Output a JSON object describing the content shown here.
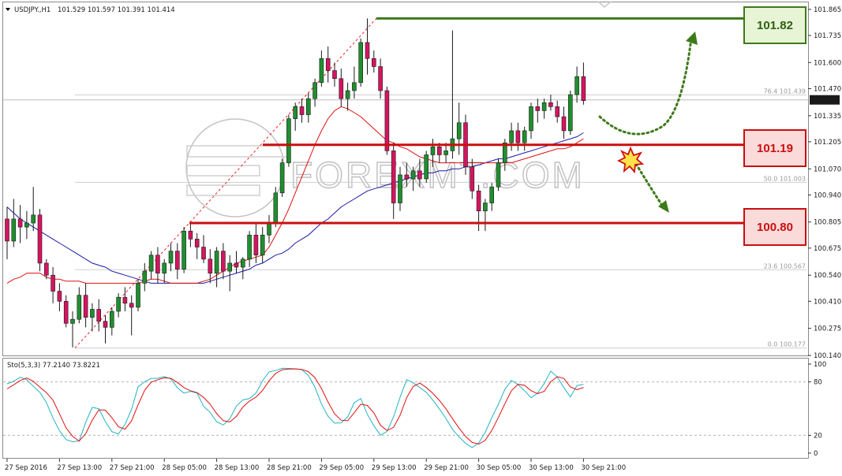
{
  "header": {
    "symbol": "USDJPY.,H1",
    "ohlc": "101.529 101.597 101.391 101.414"
  },
  "price_axis": {
    "ticks": [
      "101.865",
      "101.735",
      "101.600",
      "101.470",
      "101.335",
      "101.205",
      "101.070",
      "100.940",
      "100.805",
      "100.675",
      "100.540",
      "100.410",
      "100.275",
      "100.140"
    ],
    "current_price": "101.414"
  },
  "time_axis": {
    "ticks": [
      "27 Sep 2016",
      "27 Sep 13:00",
      "27 Sep 21:00",
      "28 Sep 05:00",
      "28 Sep 13:00",
      "28 Sep 21:00",
      "29 Sep 05:00",
      "29 Sep 13:00",
      "29 Sep 21:00",
      "30 Sep 05:00",
      "30 Sep 13:00",
      "30 Sep 21:00"
    ]
  },
  "fib_levels": [
    {
      "label": "76.4  101.439"
    },
    {
      "label": "50.0  101.003"
    },
    {
      "label": "23.6  100.567"
    },
    {
      "label": "0.0  100.177"
    }
  ],
  "levels": {
    "resistance": "101.82",
    "pivot": "101.19",
    "support": "100.80"
  },
  "indicator": {
    "label": "Sto(5,3,3) 77.2140 73.8221",
    "ticks": [
      "100",
      "80",
      "20",
      "0"
    ]
  },
  "watermark": "FOREXMT.COM",
  "colors": {
    "bull": "#1f8f2e",
    "bear": "#d6145f",
    "ma_fast": "#e01010",
    "ma_slow": "#1a1aa8",
    "stoch_main": "#24b4c4",
    "stoch_signal": "#e01010",
    "resistance_box": "#e7f5d6",
    "support_box": "#fbdada"
  },
  "chart_data": {
    "type": "candlestick",
    "timeframe": "H1",
    "xlabel": "",
    "ylabel": "",
    "ylim": [
      100.14,
      101.9
    ],
    "start": "27 Sep 2016 00:00",
    "candles": [
      [
        100.82,
        100.88,
        100.62,
        100.71
      ],
      [
        100.71,
        100.92,
        100.68,
        100.82
      ],
      [
        100.82,
        100.89,
        100.7,
        100.78
      ],
      [
        100.78,
        100.86,
        100.72,
        100.8
      ],
      [
        100.8,
        100.98,
        100.76,
        100.84
      ],
      [
        100.84,
        100.87,
        100.56,
        100.6
      ],
      [
        100.6,
        100.62,
        100.52,
        100.54
      ],
      [
        100.54,
        100.58,
        100.4,
        100.46
      ],
      [
        100.46,
        100.5,
        100.36,
        100.41
      ],
      [
        100.41,
        100.44,
        100.28,
        100.3
      ],
      [
        100.3,
        100.36,
        100.18,
        100.32
      ],
      [
        100.32,
        100.48,
        100.3,
        100.44
      ],
      [
        100.44,
        100.5,
        100.28,
        100.33
      ],
      [
        100.33,
        100.4,
        100.26,
        100.37
      ],
      [
        100.37,
        100.42,
        100.26,
        100.31
      ],
      [
        100.31,
        100.34,
        100.2,
        100.28
      ],
      [
        100.28,
        100.38,
        100.24,
        100.36
      ],
      [
        100.36,
        100.45,
        100.33,
        100.43
      ],
      [
        100.43,
        100.48,
        100.36,
        100.4
      ],
      [
        100.4,
        100.44,
        100.24,
        100.38
      ],
      [
        100.38,
        100.52,
        100.36,
        100.5
      ],
      [
        100.5,
        100.6,
        100.46,
        100.56
      ],
      [
        100.56,
        100.66,
        100.52,
        100.64
      ],
      [
        100.64,
        100.68,
        100.5,
        100.55
      ],
      [
        100.55,
        100.62,
        100.5,
        100.6
      ],
      [
        100.6,
        100.7,
        100.56,
        100.66
      ],
      [
        100.66,
        100.7,
        100.52,
        100.57
      ],
      [
        100.57,
        100.78,
        100.55,
        100.76
      ],
      [
        100.76,
        100.8,
        100.68,
        100.72
      ],
      [
        100.72,
        100.75,
        100.62,
        100.68
      ],
      [
        100.68,
        100.74,
        100.6,
        100.62
      ],
      [
        100.62,
        100.67,
        100.5,
        100.55
      ],
      [
        100.55,
        100.68,
        100.48,
        100.66
      ],
      [
        100.66,
        100.7,
        100.52,
        100.56
      ],
      [
        100.56,
        100.64,
        100.46,
        100.6
      ],
      [
        100.6,
        100.66,
        100.55,
        100.58
      ],
      [
        100.58,
        100.63,
        100.52,
        100.62
      ],
      [
        100.62,
        100.76,
        100.58,
        100.74
      ],
      [
        100.74,
        100.8,
        100.6,
        100.64
      ],
      [
        100.64,
        100.78,
        100.6,
        100.74
      ],
      [
        100.74,
        100.84,
        100.7,
        100.8
      ],
      [
        100.8,
        100.98,
        100.78,
        100.95
      ],
      [
        100.95,
        101.12,
        100.93,
        101.1
      ],
      [
        101.1,
        101.34,
        101.08,
        101.32
      ],
      [
        101.32,
        101.4,
        101.26,
        101.38
      ],
      [
        101.38,
        101.42,
        101.3,
        101.34
      ],
      [
        101.34,
        101.45,
        101.3,
        101.42
      ],
      [
        101.42,
        101.52,
        101.38,
        101.5
      ],
      [
        101.5,
        101.66,
        101.48,
        101.62
      ],
      [
        101.62,
        101.68,
        101.5,
        101.56
      ],
      [
        101.56,
        101.6,
        101.48,
        101.52
      ],
      [
        101.52,
        101.57,
        101.38,
        101.42
      ],
      [
        101.42,
        101.5,
        101.36,
        101.46
      ],
      [
        101.46,
        101.58,
        101.42,
        101.5
      ],
      [
        101.5,
        101.72,
        101.48,
        101.7
      ],
      [
        101.7,
        101.82,
        101.54,
        101.62
      ],
      [
        101.62,
        101.66,
        101.55,
        101.58
      ],
      [
        101.58,
        101.62,
        101.42,
        101.46
      ],
      [
        101.46,
        101.48,
        101.14,
        101.16
      ],
      [
        101.16,
        101.2,
        100.82,
        100.9
      ],
      [
        100.9,
        101.08,
        100.86,
        101.04
      ],
      [
        101.04,
        101.1,
        100.98,
        101.02
      ],
      [
        101.02,
        101.08,
        100.96,
        101.06
      ],
      [
        101.06,
        101.12,
        100.98,
        101.02
      ],
      [
        101.02,
        101.16,
        101.0,
        101.14
      ],
      [
        101.14,
        101.22,
        101.08,
        101.18
      ],
      [
        101.18,
        101.2,
        101.1,
        101.14
      ],
      [
        101.14,
        101.2,
        101.1,
        101.16
      ],
      [
        101.16,
        101.76,
        101.12,
        101.22
      ],
      [
        101.22,
        101.4,
        101.14,
        101.3
      ],
      [
        101.3,
        101.34,
        101.04,
        101.08
      ],
      [
        101.08,
        101.12,
        100.92,
        100.96
      ],
      [
        100.96,
        100.99,
        100.76,
        100.86
      ],
      [
        100.86,
        100.92,
        100.76,
        100.9
      ],
      [
        100.9,
        101.0,
        100.86,
        100.98
      ],
      [
        100.98,
        101.12,
        100.96,
        101.1
      ],
      [
        101.1,
        101.22,
        101.06,
        101.2
      ],
      [
        101.2,
        101.3,
        101.16,
        101.26
      ],
      [
        101.26,
        101.3,
        101.16,
        101.2
      ],
      [
        101.2,
        101.28,
        101.16,
        101.26
      ],
      [
        101.26,
        101.4,
        101.22,
        101.38
      ],
      [
        101.38,
        101.42,
        101.3,
        101.36
      ],
      [
        101.36,
        101.42,
        101.32,
        101.4
      ],
      [
        101.4,
        101.44,
        101.36,
        101.38
      ],
      [
        101.38,
        101.41,
        101.3,
        101.33
      ],
      [
        101.33,
        101.38,
        101.22,
        101.26
      ],
      [
        101.26,
        101.46,
        101.24,
        101.44
      ],
      [
        101.44,
        101.58,
        101.4,
        101.53
      ],
      [
        101.53,
        101.6,
        101.39,
        101.41
      ]
    ],
    "ma_fast": [
      100.5,
      100.52,
      100.53,
      100.55,
      100.55,
      100.55,
      100.53,
      100.52,
      100.52,
      100.51,
      100.51,
      100.51,
      100.5,
      100.5,
      100.5,
      100.5,
      100.5,
      100.5,
      100.5,
      100.5,
      100.5,
      100.51,
      100.52,
      100.52,
      100.51,
      100.5,
      100.5,
      100.5,
      100.5,
      100.5,
      100.51,
      100.52,
      100.54,
      100.56,
      100.58,
      100.6,
      100.61,
      100.62,
      100.63,
      100.64,
      100.68,
      100.74,
      100.8,
      100.87,
      100.95,
      101.03,
      101.11,
      101.19,
      101.26,
      101.32,
      101.36,
      101.38,
      101.37,
      101.35,
      101.33,
      101.3,
      101.27,
      101.24,
      101.21,
      101.2,
      101.18,
      101.17,
      101.15,
      101.13,
      101.12,
      101.11,
      101.1,
      101.1,
      101.1,
      101.1,
      101.1,
      101.1,
      101.1,
      101.1,
      101.1,
      101.1,
      101.1,
      101.1,
      101.11,
      101.12,
      101.13,
      101.14,
      101.15,
      101.16,
      101.17,
      101.17,
      101.18,
      101.2,
      101.22
    ],
    "ma_slow": [
      100.88,
      100.85,
      100.82,
      100.8,
      100.78,
      100.76,
      100.74,
      100.72,
      100.7,
      100.68,
      100.66,
      100.64,
      100.62,
      100.6,
      100.59,
      100.58,
      100.56,
      100.55,
      100.54,
      100.53,
      100.52,
      100.51,
      100.5,
      100.5,
      100.5,
      100.5,
      100.5,
      100.5,
      100.5,
      100.5,
      100.5,
      100.51,
      100.52,
      100.53,
      100.54,
      100.55,
      100.56,
      100.57,
      100.59,
      100.6,
      100.62,
      100.64,
      100.65,
      100.67,
      100.7,
      100.72,
      100.74,
      100.77,
      100.8,
      100.82,
      100.85,
      100.88,
      100.9,
      100.92,
      100.94,
      100.96,
      100.97,
      100.98,
      100.99,
      101.0,
      101.01,
      101.02,
      101.03,
      101.04,
      101.05,
      101.05,
      101.06,
      101.06,
      101.07,
      101.07,
      101.08,
      101.08,
      101.09,
      101.1,
      101.11,
      101.12,
      101.12,
      101.13,
      101.14,
      101.15,
      101.16,
      101.17,
      101.18,
      101.19,
      101.2,
      101.21,
      101.22,
      101.23,
      101.25
    ],
    "stochastic": {
      "ylim": [
        0,
        100
      ],
      "levels": [
        20,
        80
      ],
      "main": [
        77.9,
        80.6,
        85.2,
        82.5,
        75.1,
        68.3,
        56.8,
        39.6,
        25.1,
        15.2,
        12.8,
        13.7,
        34.6,
        51.3,
        49.9,
        35.5,
        24.2,
        21.6,
        32.3,
        49.1,
        74.5,
        80.2,
        83.8,
        84.1,
        86.0,
        83.4,
        73.4,
        67.4,
        69.3,
        67.4,
        52.6,
        45.7,
        35.2,
        31.6,
        38.7,
        52.8,
        59.8,
        61.2,
        67.4,
        81.3,
        91.2,
        92.7,
        95.3,
        95.1,
        94.7,
        93.6,
        87.2,
        74.0,
        55.1,
        41.4,
        33.7,
        34.0,
        40.8,
        56.6,
        61.3,
        43.6,
        30.7,
        20.2,
        24.3,
        40.7,
        62.7,
        82.5,
        79.0,
        73.7,
        68.3,
        59.6,
        49.7,
        38.9,
        26.6,
        18.2,
        11.0,
        6.3,
        11.4,
        23.4,
        39.8,
        54.9,
        71.8,
        81.7,
        77.0,
        70.2,
        62.2,
        67.4,
        78.1,
        92.1,
        85.5,
        73.7,
        63.1,
        75.9,
        77.2
      ],
      "signal": [
        72.1,
        76.7,
        81.6,
        84.5,
        80.6,
        74.1,
        68.0,
        59.6,
        44.1,
        28.4,
        18.9,
        13.6,
        21.8,
        37.1,
        48.6,
        48.3,
        39.8,
        29.6,
        26.9,
        36.2,
        54.3,
        70.5,
        79.7,
        82.5,
        84.6,
        84.1,
        79.4,
        73.6,
        70.1,
        68.0,
        62.6,
        55.0,
        44.3,
        36.5,
        35.0,
        41.2,
        51.8,
        58.5,
        62.9,
        70.4,
        81.2,
        89.6,
        93.6,
        94.5,
        94.6,
        94.1,
        91.5,
        84.8,
        72.6,
        57.4,
        44.2,
        37.0,
        36.4,
        45.4,
        55.0,
        53.5,
        45.2,
        31.4,
        25.4,
        28.9,
        42.6,
        62.3,
        74.9,
        78.7,
        73.7,
        67.2,
        59.2,
        49.8,
        38.7,
        28.1,
        18.8,
        12.0,
        10.2,
        14.3,
        25.4,
        40.0,
        55.5,
        70.1,
        77.3,
        76.2,
        70.1,
        66.8,
        69.4,
        80.3,
        85.8,
        83.9,
        74.3,
        71.2,
        73.8
      ]
    }
  }
}
